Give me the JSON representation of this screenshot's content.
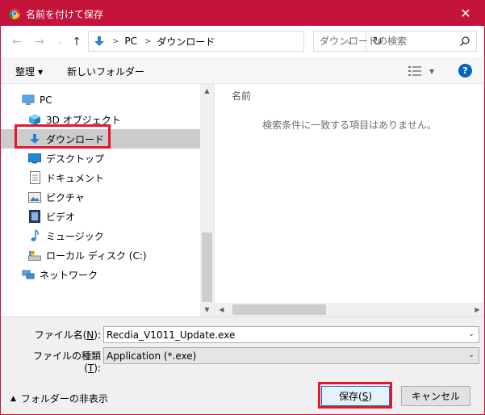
{
  "window": {
    "title": "名前を付けて保存",
    "accent_color": "#c4143c",
    "close_label": "✕"
  },
  "nav": {
    "address_root": "PC",
    "address_current": "ダウンロード",
    "search_placeholder": "ダウンロードの検索"
  },
  "toolbar": {
    "organize_label": "整理",
    "new_folder_label": "新しいフォルダー",
    "help_label": "?"
  },
  "sidebar": {
    "items": [
      {
        "label": "PC",
        "icon": "pc-icon"
      },
      {
        "label": "3D オブジェクト",
        "icon": "3d-objects-icon"
      },
      {
        "label": "ダウンロード",
        "icon": "download-arrow-icon"
      },
      {
        "label": "デスクトップ",
        "icon": "desktop-icon"
      },
      {
        "label": "ドキュメント",
        "icon": "document-icon"
      },
      {
        "label": "ピクチャ",
        "icon": "pictures-icon"
      },
      {
        "label": "ビデオ",
        "icon": "video-icon"
      },
      {
        "label": "ミュージック",
        "icon": "music-icon"
      },
      {
        "label": "ローカル ディスク (C:)",
        "icon": "drive-icon"
      },
      {
        "label": "ネットワーク",
        "icon": "network-icon"
      }
    ],
    "selected": "ダウンロード"
  },
  "content": {
    "column_name": "名前",
    "empty_message": "検索条件に一致する項目はありません。"
  },
  "form": {
    "filename_label_pre": "ファイル名(",
    "filename_label_key": "N",
    "filename_label_post": "):",
    "filename_value": "Recdia_V1011_Update.exe",
    "filetype_label_pre": "ファイルの種類(",
    "filetype_label_key": "T",
    "filetype_label_post": "):",
    "filetype_value": "Application (*.exe)",
    "hide_folders_label": "フォルダーの非表示",
    "save_label_pre": "保存(",
    "save_label_key": "S",
    "save_label_post": ")",
    "cancel_label": "キャンセル"
  },
  "colors": {
    "highlight": "#e8142d",
    "selected_row": "#cccccc",
    "help_blue": "#0067c0"
  }
}
